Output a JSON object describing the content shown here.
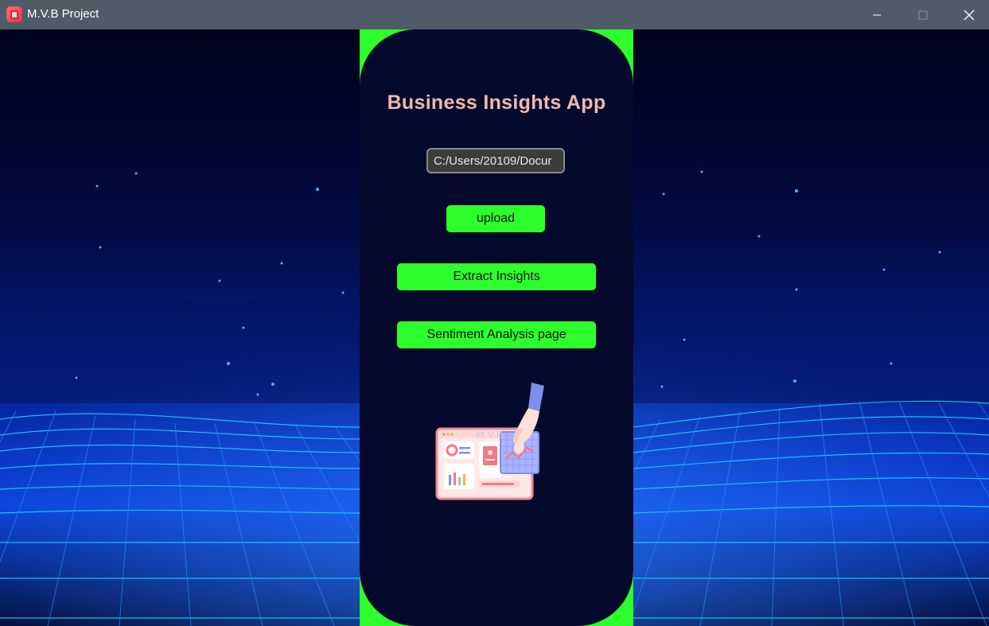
{
  "window": {
    "title": "M.V.B Project",
    "icons": {
      "app": "app-icon",
      "minimize": "minimize-icon",
      "maximize": "maximize-icon",
      "close": "close-icon"
    }
  },
  "main": {
    "title": "Business Insights App",
    "file_path": {
      "value": "C:/Users/20109/Docur"
    },
    "buttons": {
      "upload": "upload",
      "extract": "Extract Insights",
      "sentiment": "Sentiment Analysis page"
    },
    "illustration": {
      "name": "dashboard-hand-illustration",
      "watermark": "M.V.B"
    }
  },
  "colors": {
    "accent_green": "#2dff2d",
    "panel_bg": "#050a2c",
    "title_color": "#f0b8ad",
    "titlebar_bg": "#4f5b66"
  }
}
